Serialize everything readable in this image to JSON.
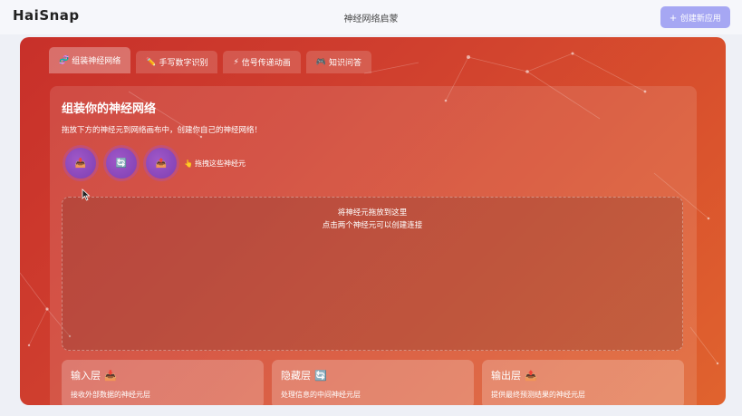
{
  "header": {
    "logo": "HaiSnap",
    "title": "神经网络启蒙",
    "create_button": "创建新应用",
    "create_icon": "+"
  },
  "tabs": [
    {
      "icon": "🧬",
      "label": "组装神经网络",
      "active": true
    },
    {
      "icon": "✏️",
      "label": "手写数字识别",
      "active": false
    },
    {
      "icon": "⚡",
      "label": "信号传递动画",
      "active": false
    },
    {
      "icon": "🎮",
      "label": "知识问答",
      "active": false
    }
  ],
  "panel": {
    "title": "组装你的神经网络",
    "description": "拖放下方的神经元到网络画布中，创建你自己的神经网络！",
    "neurons": [
      {
        "type": "input",
        "icon": "📥"
      },
      {
        "type": "hidden",
        "icon": "🔄"
      },
      {
        "type": "output",
        "icon": "📤"
      }
    ],
    "drag_hint_icon": "👆",
    "drag_hint": "拖拽这些神经元",
    "drop_zone": {
      "line1": "将神经元拖放到这里",
      "line2": "点击两个神经元可以创建连接"
    },
    "layers": [
      {
        "name": "输入层",
        "icon": "📥",
        "desc": "接收外部数据的神经元层"
      },
      {
        "name": "隐藏层",
        "icon": "🔄",
        "desc": "处理信息的中间神经元层"
      },
      {
        "name": "输出层",
        "icon": "📤",
        "desc": "提供最终预测结果的神经元层"
      }
    ]
  },
  "colors": {
    "accent_button": "#a6a7f3",
    "stage_start": "#c8302a",
    "stage_end": "#e0632e",
    "neuron": "#8e48bd"
  }
}
